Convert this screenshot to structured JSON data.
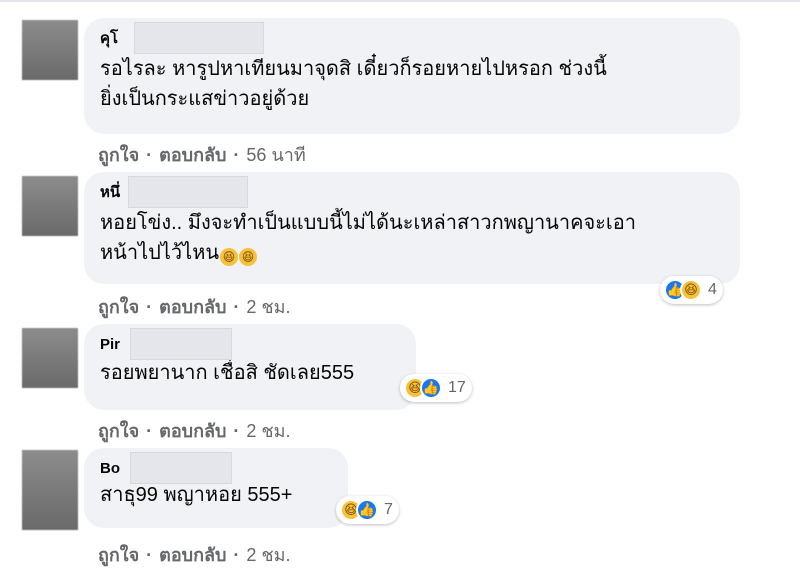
{
  "comments": [
    {
      "name": "คุโ",
      "text_lines": [
        "รอไรละ หารูปหาเทียนมาจุดสิ เดี๋ยวก็รอยหายไปหรอก ช่วงนี้",
        "ยิ่งเป็นกระแสข่าวอยู่ด้วย"
      ],
      "like_label": "ถูกใจ",
      "reply_label": "ตอบกลับ",
      "time": "56 นาที"
    },
    {
      "name": "หนึ่",
      "text_lines": [
        "หอยโข่ง.. มึงจะทำเป็นแบบนี้ไม่ได้นะเหล่าสาวกพญานาคจะเอา",
        "หน้าไปไว้ไหน"
      ],
      "emoji": [
        "grinning-squint-emoji",
        "grinning-squint-emoji"
      ],
      "reactions": {
        "icons": [
          "like",
          "haha"
        ],
        "count": "4"
      },
      "like_label": "ถูกใจ",
      "reply_label": "ตอบกลับ",
      "time": "2 ชม."
    },
    {
      "name": "Pir",
      "text_lines": [
        "รอยพยานาก เชื่อสิ ชัดเลย555"
      ],
      "reactions": {
        "icons": [
          "haha",
          "like"
        ],
        "count": "17"
      },
      "like_label": "ถูกใจ",
      "reply_label": "ตอบกลับ",
      "time": "2 ชม."
    },
    {
      "name": "Bo",
      "text_lines": [
        "สาธุ99 พญาหอย 555+"
      ],
      "reactions": {
        "icons": [
          "haha",
          "like"
        ],
        "count": "7"
      },
      "like_label": "ถูกใจ",
      "reply_label": "ตอบกลับ",
      "time": "2 ชม."
    }
  ],
  "colors": {
    "bubble": "#f0f2f5",
    "meta_text": "#65676b",
    "like_blue": "#1877f2",
    "haha_yellow": "#f7c23b"
  }
}
